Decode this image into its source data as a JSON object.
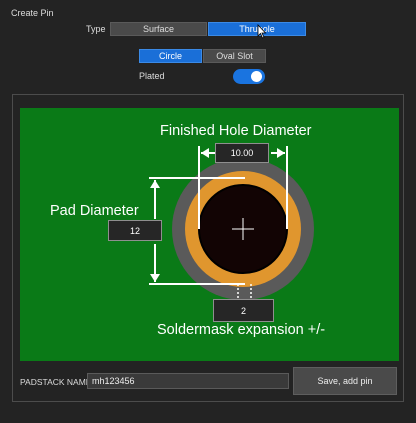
{
  "dialog": {
    "title": "Create Pin"
  },
  "type": {
    "label": "Type",
    "options": [
      "Surface",
      "Thruhole"
    ],
    "selected": "Thruhole"
  },
  "shape": {
    "options": [
      "Circle",
      "Oval Slot"
    ],
    "selected": "Circle"
  },
  "plated": {
    "label": "Plated",
    "value": true
  },
  "diagram": {
    "finished_hole_label": "Finished Hole Diameter",
    "finished_hole_value": "10.00",
    "pad_label": "Pad Diameter",
    "pad_value": "12",
    "soldermask_label": "Soldermask expansion +/-",
    "soldermask_value": "2",
    "colors": {
      "board": "#0a7a17",
      "soldermask": "#5a5a5a",
      "pad": "#e0962e",
      "hole": "#120404"
    }
  },
  "padstack": {
    "label": "PADSTACK NAME",
    "value": "mh123456"
  },
  "actions": {
    "save_label": "Save, add pin"
  }
}
